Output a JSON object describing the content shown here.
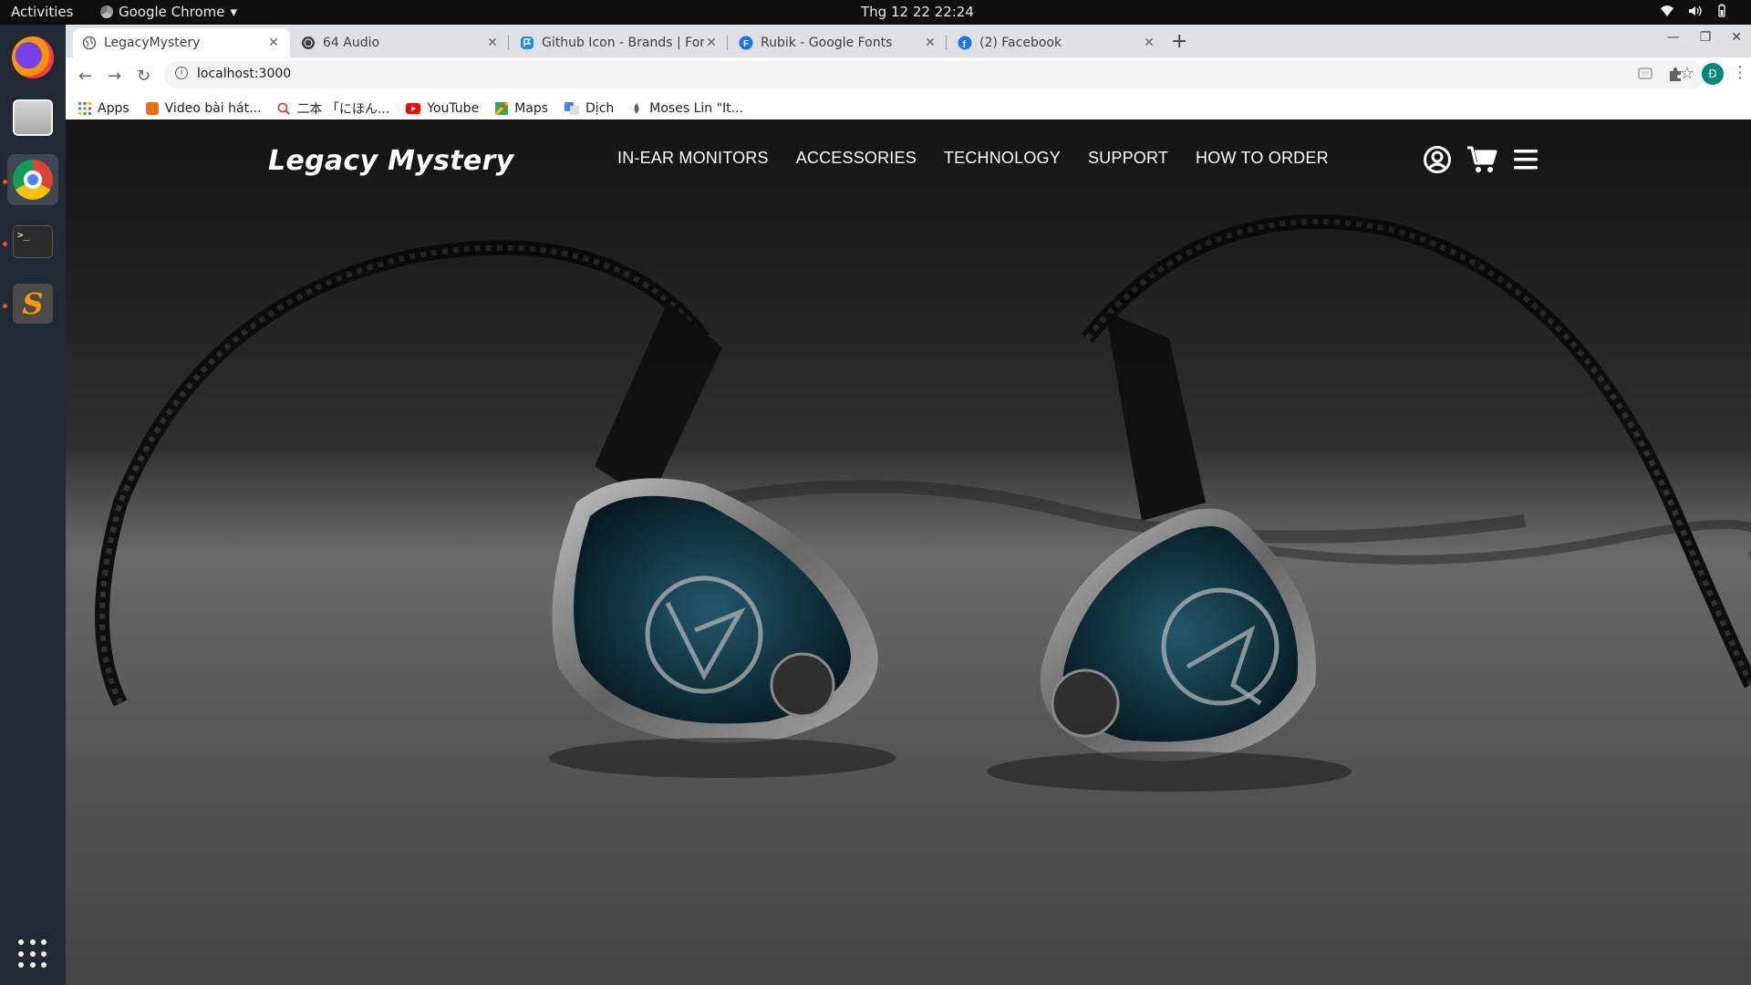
{
  "os_topbar": {
    "activities": "Activities",
    "app_name": "Google Chrome",
    "clock": "Thg 12 22  22:24"
  },
  "browser": {
    "tabs": [
      {
        "title": "LegacyMystery",
        "active": true,
        "favicon": "globe-icon"
      },
      {
        "title": "64 Audio",
        "active": false,
        "favicon": "64audio-icon"
      },
      {
        "title": "Github Icon - Brands | Fon",
        "active": false,
        "favicon": "fontawesome-icon"
      },
      {
        "title": "Rubik - Google Fonts",
        "active": false,
        "favicon": "google-fonts-icon"
      },
      {
        "title": "(2) Facebook",
        "active": false,
        "favicon": "facebook-icon"
      }
    ],
    "url": "localhost:3000",
    "profile_initial": "Đ",
    "bookmarks": [
      {
        "label": "Apps",
        "icon": "apps-grid-icon",
        "color": "#4285f4"
      },
      {
        "label": "Video bài hát...",
        "icon": "bookmark-icon",
        "color": "#e8710a"
      },
      {
        "label": "二本 「にほん...",
        "icon": "search-icon",
        "color": "#d93025"
      },
      {
        "label": "YouTube",
        "icon": "youtube-icon",
        "color": "#ff0000"
      },
      {
        "label": "Maps",
        "icon": "maps-icon",
        "color": "#34a853"
      },
      {
        "label": "Dịch",
        "icon": "translate-icon",
        "color": "#4285f4"
      },
      {
        "label": "Moses Lin \"It...",
        "icon": "site-icon",
        "color": "#5f6368"
      }
    ]
  },
  "site": {
    "logo": "Legacy Mystery",
    "nav": [
      {
        "label": "IN-EAR MONITORS"
      },
      {
        "label": "ACCESSORIES"
      },
      {
        "label": "TECHNOLOGY"
      },
      {
        "label": "SUPPORT"
      },
      {
        "label": "HOW TO ORDER"
      }
    ],
    "header_icons": [
      "user-circle-icon",
      "cart-icon",
      "hamburger-menu-icon"
    ]
  }
}
